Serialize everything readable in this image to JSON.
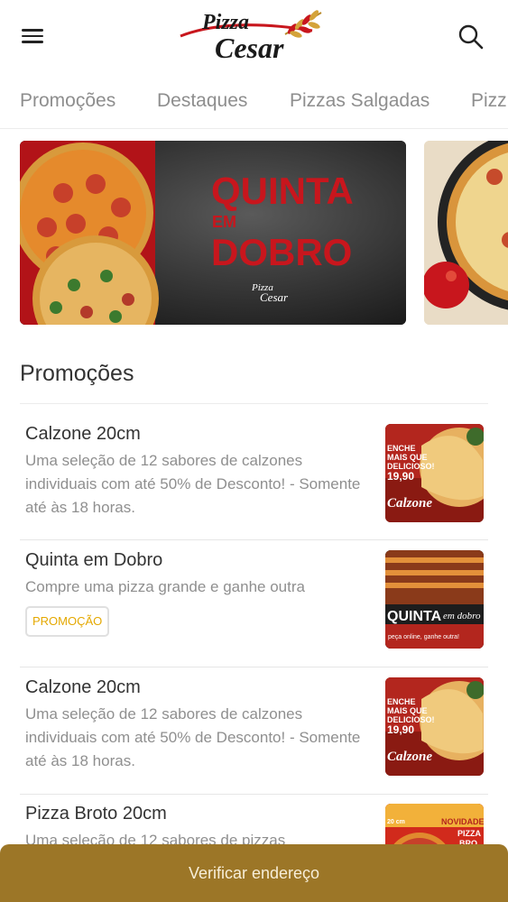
{
  "header": {
    "menu_icon": "hamburger-menu-icon",
    "search_icon": "search-icon",
    "logo_top": "Pizza",
    "logo_bottom": "Cesar"
  },
  "tabs": [
    {
      "label": "Promoções"
    },
    {
      "label": "Destaques"
    },
    {
      "label": "Pizzas Salgadas"
    },
    {
      "label": "Pizz"
    }
  ],
  "banners": [
    {
      "line1": "QUINTA",
      "line2": "EM",
      "line3": "DOBRO",
      "brand_top": "Pizza",
      "brand_bottom": "Cesar"
    },
    {}
  ],
  "section": {
    "title": "Promoções"
  },
  "items": [
    {
      "name": "Calzone 20cm",
      "desc": "Uma seleção de 12 sabores de calzones individuais com até 50% de Desconto! - Somente até às 18 horas.",
      "img_text1": "ENCHE",
      "img_text2": "MAIS QUE",
      "img_text3": "DELICIOSO!",
      "img_price": "19,90",
      "img_label": "Calzone"
    },
    {
      "name": "Quinta em Dobro",
      "desc": "Compre uma pizza grande e ganhe outra",
      "badge": "PROMOÇÃO",
      "img_text1": "QUINTA",
      "img_text2": "em dobro",
      "img_text3": "peça online, ganhe outra!"
    },
    {
      "name": "Calzone 20cm",
      "desc": "Uma seleção de 12 sabores de calzones individuais com até 50% de Desconto! - Somente até às 18 horas.",
      "img_text1": "ENCHE",
      "img_text2": "MAIS QUE",
      "img_text3": "DELICIOSO!",
      "img_price": "19,90",
      "img_label": "Calzone"
    },
    {
      "name": "Pizza Broto 20cm",
      "desc": "Uma seleção de 12 sabores de pizzas",
      "img_text1": "NOVIDADE",
      "img_text2": "PIZZA",
      "img_text3": "BRO",
      "img_text4": "20 cm"
    }
  ],
  "cta": {
    "label": "Verificar endereço"
  },
  "colors": {
    "accent": "#9c7627",
    "badge": "#e4a800",
    "brand_red": "#c8161d"
  }
}
